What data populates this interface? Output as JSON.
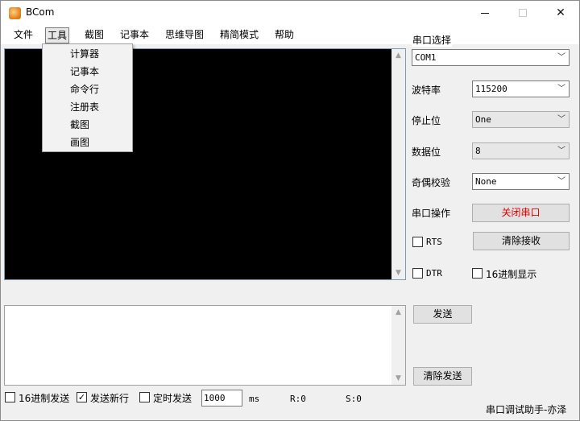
{
  "window": {
    "title": "BCom"
  },
  "menu": {
    "items": [
      "文件",
      "工具",
      "截图",
      "记事本",
      "思维导图",
      "精简模式",
      "帮助"
    ],
    "dropdown": [
      "计算器",
      "记事本",
      "命令行",
      "注册表",
      "截图",
      "画图"
    ]
  },
  "panel": {
    "port_label": "串口选择",
    "port_value": "COM1",
    "baud_label": "波特率",
    "baud_value": "115200",
    "stop_label": "停止位",
    "stop_value": "One",
    "data_label": "数据位",
    "data_value": "8",
    "parity_label": "奇偶校验",
    "parity_value": "None",
    "op_label": "串口操作",
    "close_port_button": "关闭串口",
    "rts_label": "RTS",
    "clear_recv_button": "清除接收",
    "dtr_label": "DTR",
    "hex_display_label": "16进制显示",
    "send_button": "发送",
    "clear_send_button": "清除发送"
  },
  "bottom": {
    "hex_send_label": "16进制发送",
    "newline_label": "发送新行",
    "timed_send_label": "定时发送",
    "interval_value": "1000",
    "interval_unit": "ms",
    "rx_count": "R:0",
    "tx_count": "S:0",
    "credit": "串口调试助手-亦泽"
  },
  "state": {
    "newline_checked": true,
    "hex_send_checked": false,
    "timed_send_checked": false,
    "rts_checked": false,
    "dtr_checked": false,
    "hex_display_checked": false
  },
  "colors": {
    "close_port_text": "#e00000",
    "receive_bg": "#000000"
  },
  "icons": {
    "app": "bcom-app-icon",
    "check": "✓"
  }
}
